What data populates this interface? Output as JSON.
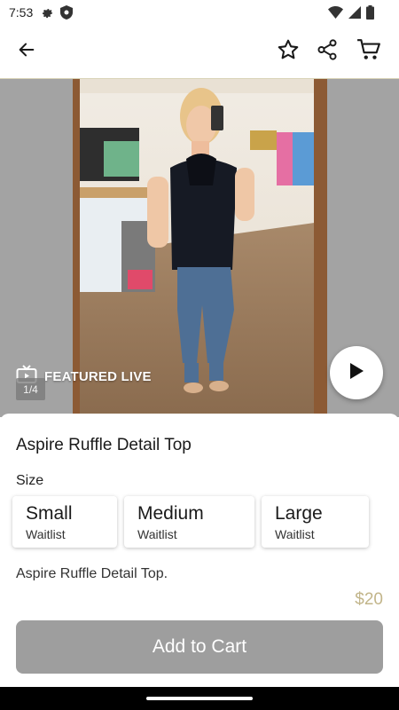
{
  "status_bar": {
    "time": "7:53",
    "icons": [
      "gear-icon",
      "shield-icon",
      "wifi-icon",
      "signal-icon",
      "battery-icon"
    ]
  },
  "app_bar": {
    "icons": [
      "back-arrow-icon",
      "star-icon",
      "share-icon",
      "cart-icon"
    ]
  },
  "media": {
    "featured_label": "FEATURED LIVE",
    "counter": "1/4",
    "icons": [
      "tv-icon",
      "play-icon"
    ]
  },
  "product": {
    "title": "Aspire Ruffle Detail Top",
    "size_label": "Size",
    "sizes": [
      {
        "name": "Small",
        "status": "Waitlist"
      },
      {
        "name": "Medium",
        "status": "Waitlist"
      },
      {
        "name": "Large",
        "status": "Waitlist"
      }
    ],
    "description": "Aspire Ruffle Detail Top.",
    "price": "$20"
  },
  "cta": {
    "add_to_cart_label": "Add to Cart"
  },
  "colors": {
    "accent_price": "#c2b58a",
    "cta_bg": "#9e9e9e",
    "nav_bar": "#000000"
  }
}
